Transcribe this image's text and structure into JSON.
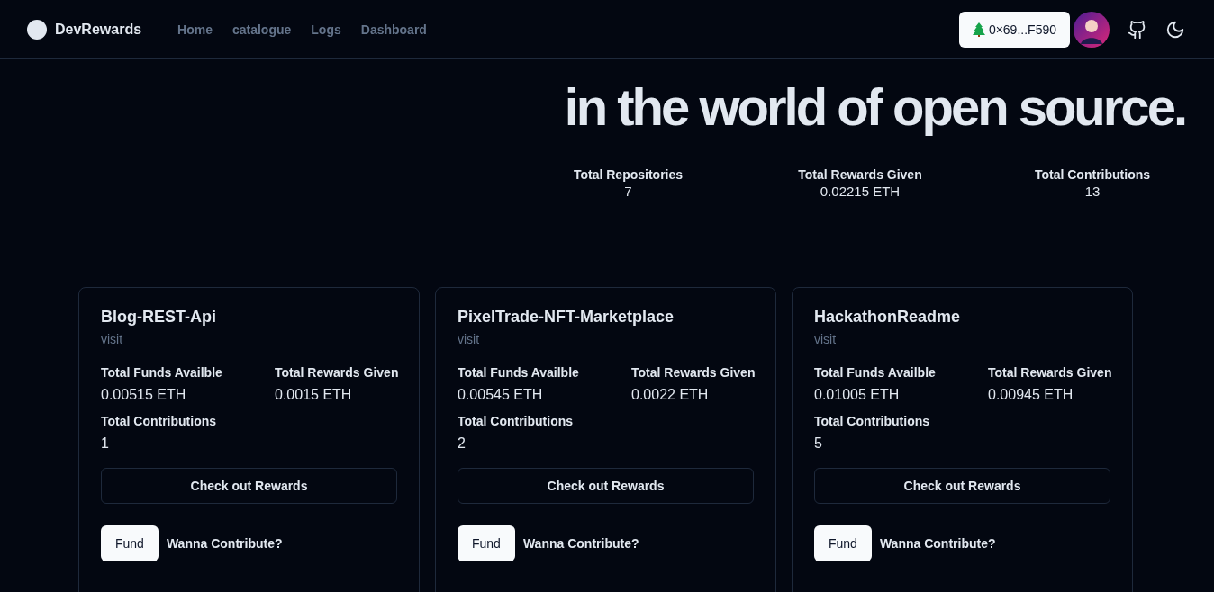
{
  "header": {
    "brand": "DevRewards",
    "nav": [
      {
        "label": "Home"
      },
      {
        "label": "catalogue"
      },
      {
        "label": "Logs"
      },
      {
        "label": "Dashboard"
      }
    ],
    "wallet": "0×69...F590"
  },
  "hero": {
    "lines": [
      "in the world of open source."
    ]
  },
  "stats": [
    {
      "label": "Total Repositories",
      "value": "7"
    },
    {
      "label": "Total Rewards Given",
      "value": "0.02215 ETH"
    },
    {
      "label": "Total Contributions",
      "value": "13"
    }
  ],
  "repos": [
    {
      "name": "Blog-REST-Api",
      "link": "visit",
      "funds_label": "Total Funds Availble",
      "funds": "0.00515 ETH",
      "rewards_label": "Total Rewards Given",
      "rewards": "0.0015 ETH",
      "contrib_label": "Total Contributions",
      "contrib": "1",
      "rewards_button": "Check out Rewards",
      "fund_button": "Fund",
      "contribute": "Wanna Contribute?"
    },
    {
      "name": "PixelTrade-NFT-Marketplace",
      "link": "visit",
      "funds_label": "Total Funds Availble",
      "funds": "0.00545 ETH",
      "rewards_label": "Total Rewards Given",
      "rewards": "0.0022 ETH",
      "contrib_label": "Total Contributions",
      "contrib": "2",
      "rewards_button": "Check out Rewards",
      "fund_button": "Fund",
      "contribute": "Wanna Contribute?"
    },
    {
      "name": "HackathonReadme",
      "link": "visit",
      "funds_label": "Total Funds Availble",
      "funds": "0.01005 ETH",
      "rewards_label": "Total Rewards Given",
      "rewards": "0.00945 ETH",
      "contrib_label": "Total Contributions",
      "contrib": "5",
      "rewards_button": "Check out Rewards",
      "fund_button": "Fund",
      "contribute": "Wanna Contribute?"
    }
  ]
}
